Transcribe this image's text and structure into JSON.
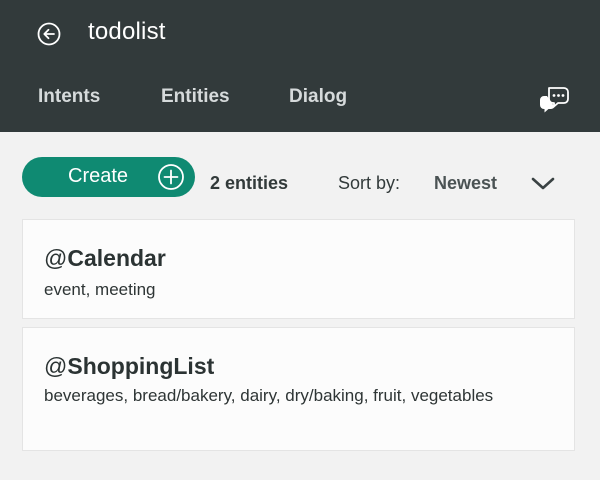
{
  "header": {
    "back_icon": "arrow-left-circle-icon",
    "title": "todolist",
    "tabs": [
      {
        "label": "Intents"
      },
      {
        "label": "Entities"
      },
      {
        "label": "Dialog"
      }
    ],
    "chat_icon": "chat-bubbles-icon"
  },
  "toolbar": {
    "create_label": "Create",
    "create_icon": "plus-circle-icon",
    "entity_count": "2 entities",
    "sort_label": "Sort by:",
    "sort_value": "Newest",
    "sort_icon": "chevron-down-icon"
  },
  "entities": [
    {
      "prefix": "@",
      "name": "Calendar",
      "values": "event,  meeting"
    },
    {
      "prefix": "@",
      "name": "ShoppingList",
      "values": "beverages,  bread/bakery,  dairy,  dry/baking,  fruit,  vegetables"
    }
  ],
  "colors": {
    "header_bg": "#323a3b",
    "page_bg": "#f2f2f2",
    "accent_green": "#0f8a72",
    "card_bg": "#fcfcfc"
  }
}
